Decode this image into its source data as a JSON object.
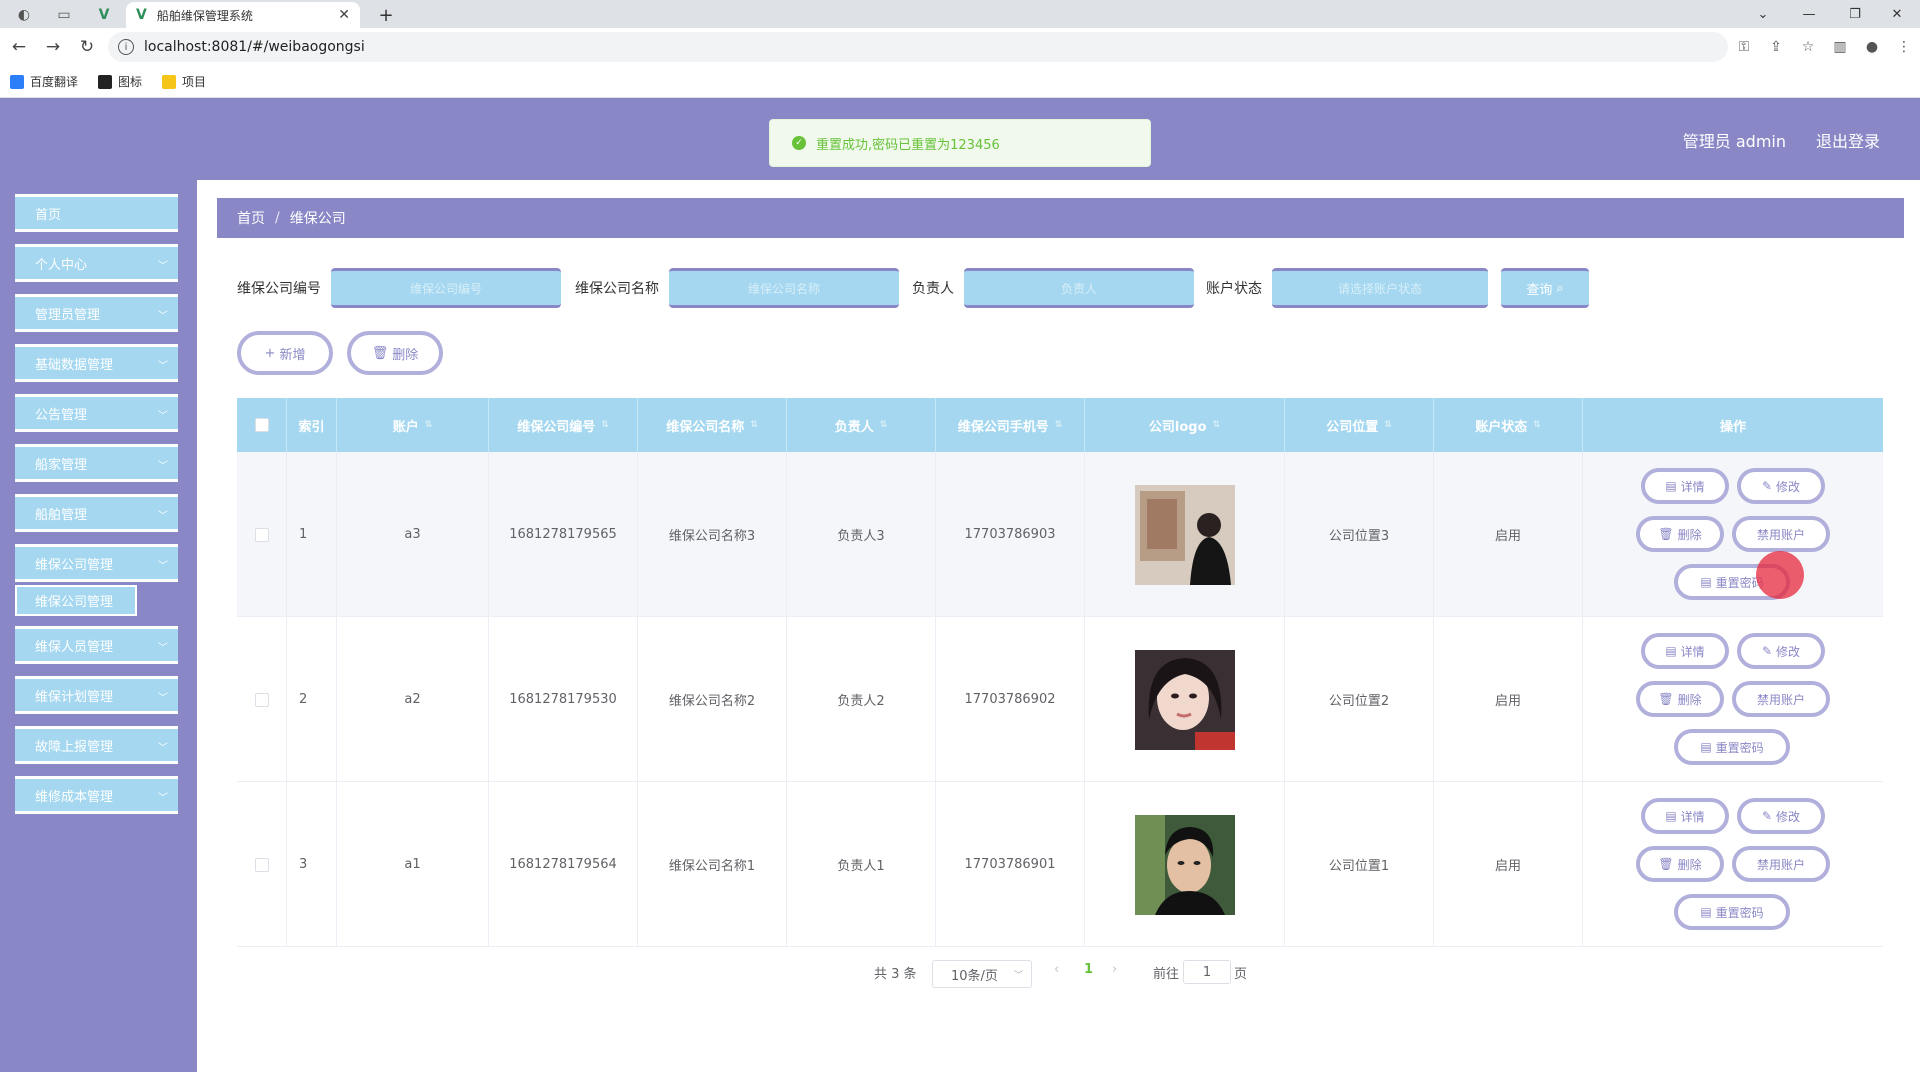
{
  "browser": {
    "tab_title": "船舶维保管理系统",
    "url": "localhost:8081/#/weibaogongsi",
    "bookmarks": [
      "百度翻译",
      "图标",
      "项目"
    ]
  },
  "header": {
    "user_label": "管理员 admin",
    "logout_label": "退出登录"
  },
  "toast": {
    "message": "重置成功,密码已重置为123456",
    "color": "#67c23a"
  },
  "sidebar": {
    "items": [
      {
        "label": "首页",
        "has_children": false
      },
      {
        "label": "个人中心",
        "has_children": true
      },
      {
        "label": "管理员管理",
        "has_children": true
      },
      {
        "label": "基础数据管理",
        "has_children": true
      },
      {
        "label": "公告管理",
        "has_children": true
      },
      {
        "label": "船家管理",
        "has_children": true
      },
      {
        "label": "船舶管理",
        "has_children": true
      },
      {
        "label": "维保公司管理",
        "has_children": true
      },
      {
        "label": "维保人员管理",
        "has_children": true
      },
      {
        "label": "维保计划管理",
        "has_children": true
      },
      {
        "label": "故障上报管理",
        "has_children": true
      },
      {
        "label": "维修成本管理",
        "has_children": true
      }
    ],
    "active_submenu": "维保公司管理"
  },
  "breadcrumb": [
    "首页",
    "维保公司"
  ],
  "filters": {
    "labels": [
      "维保公司编号",
      "维保公司名称",
      "负责人",
      "账户状态"
    ],
    "placeholders": [
      "维保公司编号",
      "维保公司名称",
      "负责人",
      "请选择账户状态"
    ],
    "query_label": "查询"
  },
  "toolbar": {
    "add_label": "新增",
    "delete_label": "删除"
  },
  "table": {
    "columns": [
      "索引",
      "账户",
      "维保公司编号",
      "维保公司名称",
      "负责人",
      "维保公司手机号",
      "公司logo",
      "公司位置",
      "账户状态",
      "操作"
    ],
    "rows": [
      {
        "index": "1",
        "account": "a3",
        "code": "1681278179565",
        "name": "维保公司名称3",
        "manager": "负责人3",
        "phone": "17703786903",
        "location": "公司位置3",
        "status": "启用"
      },
      {
        "index": "2",
        "account": "a2",
        "code": "1681278179530",
        "name": "维保公司名称2",
        "manager": "负责人2",
        "phone": "17703786902",
        "location": "公司位置2",
        "status": "启用"
      },
      {
        "index": "3",
        "account": "a1",
        "code": "1681278179564",
        "name": "维保公司名称1",
        "manager": "负责人1",
        "phone": "17703786901",
        "location": "公司位置1",
        "status": "启用"
      }
    ],
    "actions": [
      "详情",
      "修改",
      "删除",
      "禁用账户",
      "重置密码"
    ]
  },
  "pagination": {
    "total_label": "共 3 条",
    "page_size": "10条/页",
    "current_page": "1",
    "goto_label": "前往",
    "goto_value": "1",
    "page_unit": "页"
  },
  "theme": {
    "primary": "#8987c6",
    "accent": "#a5d8f0"
  }
}
